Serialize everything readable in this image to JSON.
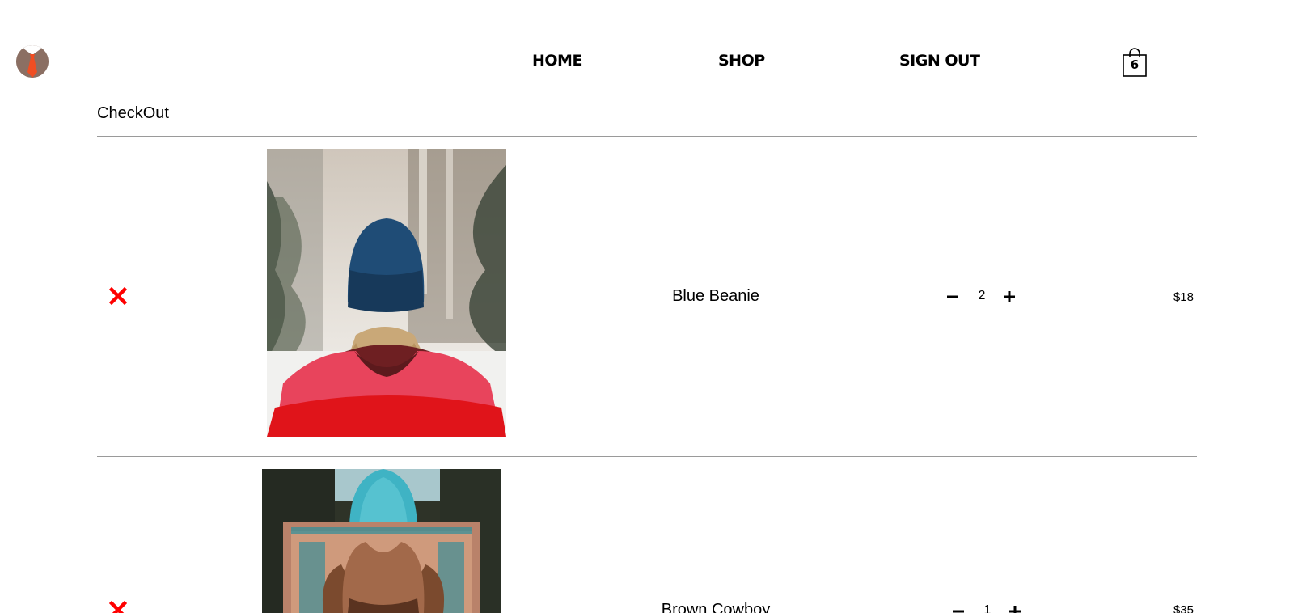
{
  "nav": {
    "home": "HOME",
    "shop": "SHOP",
    "sign_out": "SIGN OUT",
    "cart_count": "6",
    "cart_icon": "shopping-bag-icon"
  },
  "page": {
    "title": "CheckOut"
  },
  "cart_items": [
    {
      "name": "Blue Beanie",
      "quantity": "2",
      "price": "$18"
    },
    {
      "name": "Brown Cowboy",
      "quantity": "1",
      "price": "$35"
    }
  ],
  "colors": {
    "remove": "#ff0000",
    "logo": "#8b6f63",
    "tie": "#f04e23",
    "divider": "#9a9a9a"
  }
}
